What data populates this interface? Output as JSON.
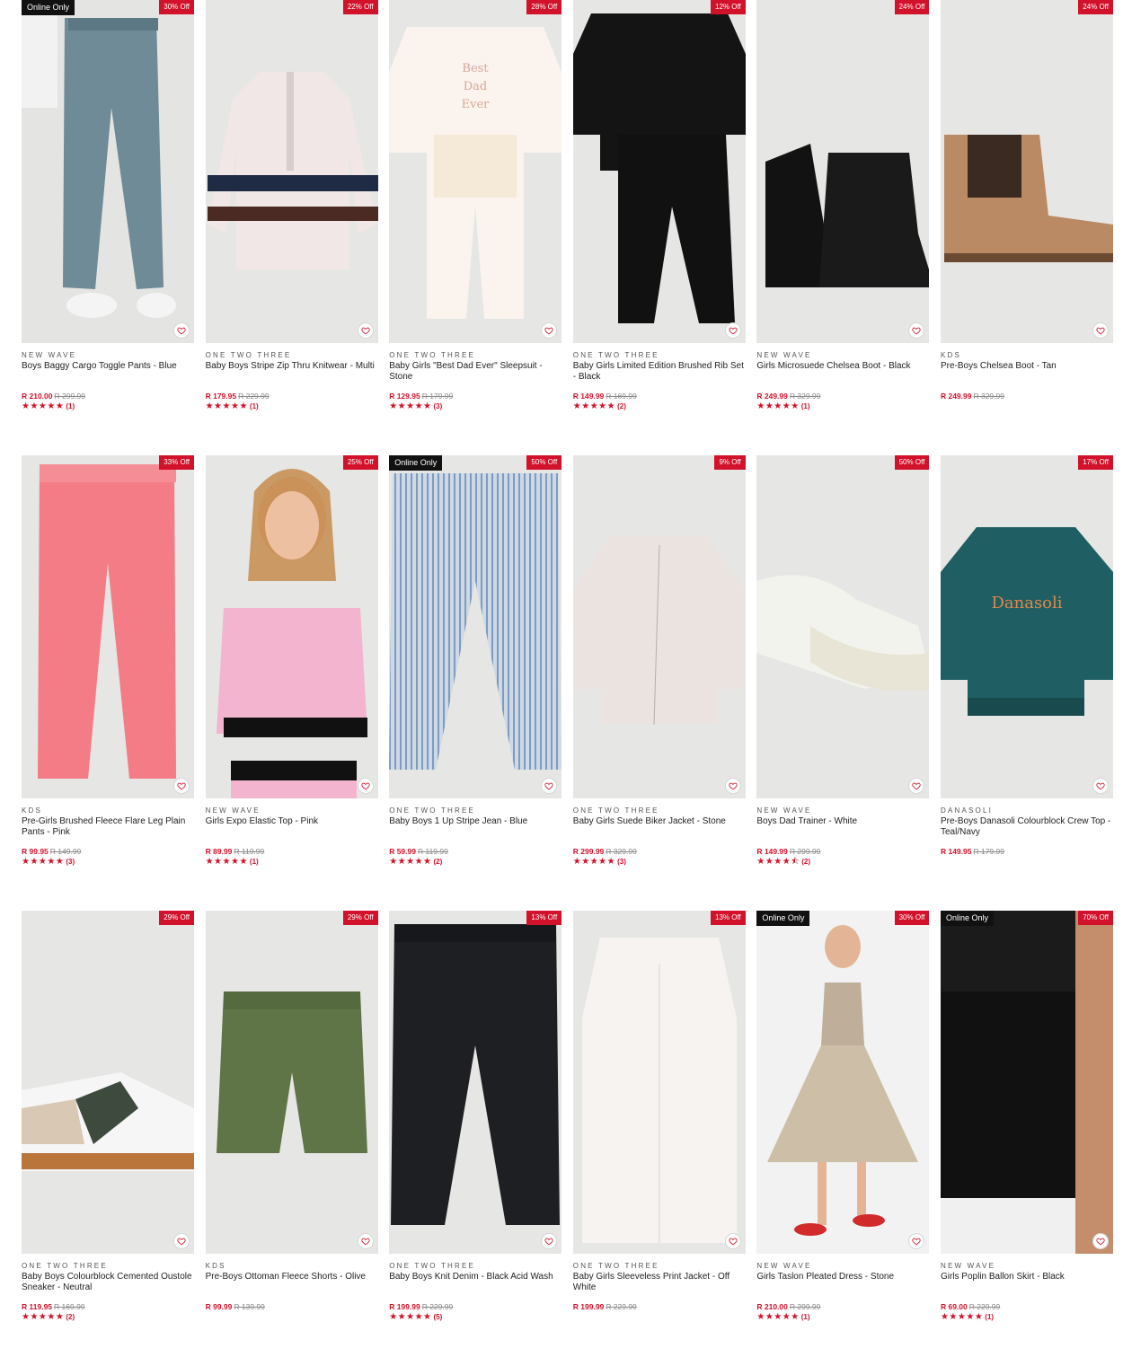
{
  "colors": {
    "accent": "#d2112a",
    "online_badge_bg": "#111111",
    "image_bg": "#e6e6e4"
  },
  "wishlist_icon": "heart-outline-icon",
  "products": [
    {
      "brand": "NEW WAVE",
      "name": "Boys Baggy Cargo Toggle Pants - Blue",
      "price": "R 210.00",
      "was": "R 299.99",
      "discount": "30% Off",
      "online_only": "Online Only",
      "stars": "★★★★★",
      "reviews": "(1)",
      "art": "pants-blue"
    },
    {
      "brand": "ONE TWO THREE",
      "name": "Baby Boys Stripe Zip Thru Knitwear - Multi",
      "price": "R 179.95",
      "was": "R 229.99",
      "discount": "22% Off",
      "online_only": "",
      "stars": "★★★★★",
      "reviews": "(1)",
      "art": "knit"
    },
    {
      "brand": "ONE TWO THREE",
      "name": "Baby Girls \"Best Dad Ever\" Sleepsuit - Stone",
      "price": "R 129.95",
      "was": "R 179.99",
      "discount": "28% Off",
      "online_only": "",
      "stars": "★★★★★",
      "reviews": "(3)",
      "art": "sleepsuit"
    },
    {
      "brand": "ONE TWO THREE",
      "name": "Baby Girls Limited Edition Brushed Rib Set - Black",
      "price": "R 149.99",
      "was": "R 169.99",
      "discount": "12% Off",
      "online_only": "",
      "stars": "★★★★★",
      "reviews": "(2)",
      "art": "black-set"
    },
    {
      "brand": "NEW WAVE",
      "name": "Girls Microsuede Chelsea Boot - Black",
      "price": "R 249.99",
      "was": "R 329.99",
      "discount": "24% Off",
      "online_only": "",
      "stars": "★★★★★",
      "reviews": "(1)",
      "art": "boots-black"
    },
    {
      "brand": "KDS",
      "name": "Pre-Boys Chelsea Boot - Tan",
      "price": "R 249.99",
      "was": "R 329.99",
      "discount": "24% Off",
      "online_only": "",
      "stars": "",
      "reviews": "",
      "art": "boot-tan"
    },
    {
      "brand": "KDS",
      "name": "Pre-Girls Brushed Fleece Flare Leg Plain Pants - Pink",
      "price": "R 99.95",
      "was": "R 149.99",
      "discount": "33% Off",
      "online_only": "",
      "stars": "★★★★★",
      "reviews": "(3)",
      "art": "pink-pants"
    },
    {
      "brand": "NEW WAVE",
      "name": "Girls Expo Elastic Top - Pink",
      "price": "R 89.99",
      "was": "R 119.99",
      "discount": "25% Off",
      "online_only": "",
      "stars": "★★★★★",
      "reviews": "(1)",
      "art": "girl-top"
    },
    {
      "brand": "ONE TWO THREE",
      "name": "Baby Boys 1 Up Stripe Jean - Blue",
      "price": "R 59.99",
      "was": "R 119.99",
      "discount": "50% Off",
      "online_only": "Online Only",
      "stars": "★★★★★",
      "reviews": "(2)",
      "art": "stripe-jean"
    },
    {
      "brand": "ONE TWO THREE",
      "name": "Baby Girls Suede Biker Jacket - Stone",
      "price": "R 299.99",
      "was": "R 329.99",
      "discount": "9% Off",
      "online_only": "",
      "stars": "★★★★★",
      "reviews": "(3)",
      "art": "biker-jacket"
    },
    {
      "brand": "NEW WAVE",
      "name": "Boys Dad Trainer - White",
      "price": "R 149.99",
      "was": "R 299.99",
      "discount": "50% Off",
      "online_only": "",
      "stars": "★★★★⯪",
      "reviews": "(2)",
      "art": "trainer"
    },
    {
      "brand": "DANASOLI",
      "name": "Pre-Boys Danasoli Colourblock Crew Top - Teal/Navy",
      "price": "R 149.95",
      "was": "R 179.99",
      "discount": "17% Off",
      "online_only": "",
      "stars": "",
      "reviews": "",
      "art": "crew-top"
    },
    {
      "brand": "ONE TWO THREE",
      "name": "Baby Boys Colourblock Cemented Oustole Sneaker - Neutral",
      "price": "R 119.95",
      "was": "R 169.99",
      "discount": "29% Off",
      "online_only": "",
      "stars": "★★★★★",
      "reviews": "(2)",
      "art": "sneaker"
    },
    {
      "brand": "KDS",
      "name": "Pre-Boys Ottoman Fleece Shorts - Olive",
      "price": "R 99.99",
      "was": "R 139.99",
      "discount": "29% Off",
      "online_only": "",
      "stars": "",
      "reviews": "",
      "art": "shorts"
    },
    {
      "brand": "ONE TWO THREE",
      "name": "Baby Boys Knit Denim - Black Acid Wash",
      "price": "R 199.99",
      "was": "R 229.99",
      "discount": "13% Off",
      "online_only": "",
      "stars": "★★★★★",
      "reviews": "(5)",
      "art": "black-denim"
    },
    {
      "brand": "ONE TWO THREE",
      "name": "Baby Girls Sleeveless Print Jacket - Off White",
      "price": "R 199.99",
      "was": "R 229.99",
      "discount": "13% Off",
      "online_only": "",
      "stars": "",
      "reviews": "",
      "art": "gilet"
    },
    {
      "brand": "NEW WAVE",
      "name": "Girls Taslon Pleated Dress - Stone",
      "price": "R 210.00",
      "was": "R 299.99",
      "discount": "30% Off",
      "online_only": "Online Only",
      "stars": "★★★★★",
      "reviews": "(1)",
      "art": "dress"
    },
    {
      "brand": "NEW WAVE",
      "name": "Girls Poplin Ballon Skirt - Black",
      "price": "R 69.00",
      "was": "R 229.99",
      "discount": "70% Off",
      "online_only": "Online Only",
      "stars": "★★★★★",
      "reviews": "(1)",
      "art": "skirt"
    }
  ]
}
